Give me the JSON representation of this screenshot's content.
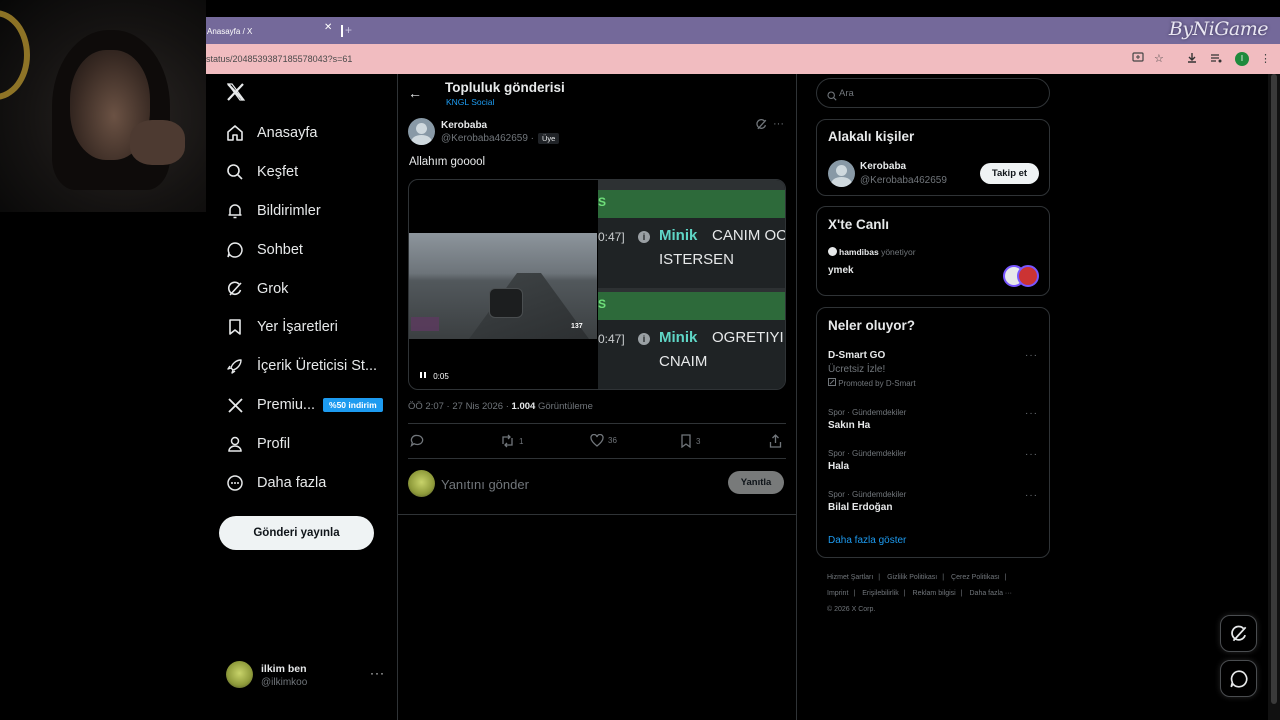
{
  "browser": {
    "tab_title": "Anasayfa / X",
    "tab_close": "✕",
    "new_tab": "+",
    "url": "status/2048539387185578043?s=61",
    "brand_watermark": "ByNiGame",
    "profile_initial": "I"
  },
  "nav": {
    "items": [
      {
        "label": "Anasayfa",
        "icon": "home-icon"
      },
      {
        "label": "Keşfet",
        "icon": "search-icon"
      },
      {
        "label": "Bildirimler",
        "icon": "bell-icon"
      },
      {
        "label": "Sohbet",
        "icon": "chat-icon"
      },
      {
        "label": "Grok",
        "icon": "grok-icon"
      },
      {
        "label": "Yer İşaretleri",
        "icon": "bookmark-icon"
      },
      {
        "label": "İçerik Üreticisi St...",
        "icon": "rocket-icon"
      },
      {
        "label": "Premiu...",
        "icon": "x-icon",
        "badge": "%50 indirim"
      },
      {
        "label": "Profil",
        "icon": "person-icon"
      },
      {
        "label": "Daha fazla",
        "icon": "more-circle-icon"
      }
    ],
    "post_button": "Gönderi yayınla",
    "account": {
      "name": "ilkim ben",
      "handle": "@ilkimkoo",
      "more": "···"
    }
  },
  "main": {
    "back": "←",
    "title": "Topluluk gönderisi",
    "community": "KNGL Social",
    "post": {
      "author": "Kerobaba",
      "handle": "@Kerobaba462659",
      "separator": "·",
      "member_badge": "Üye",
      "text": "Allahım gooool",
      "video_time": "0:05",
      "chat": [
        {
          "time": "0:47]",
          "user": "Minik",
          "msg": "CANIM OC",
          "msg2": "ISTERSEN"
        },
        {
          "time": "0:47]",
          "user": "Minik",
          "msg": "OGRETIYI",
          "msg2": "CNAIM"
        }
      ],
      "chat_markers": [
        "S",
        "S"
      ],
      "hud_speed": "137",
      "time": "ÖÖ 2:07",
      "date": "27 Nis 2026",
      "views": "1.004",
      "views_label": "Görüntüleme",
      "actions": {
        "replies": "",
        "reposts": "1",
        "likes": "36",
        "bookmarks": "3"
      },
      "more": "···"
    },
    "reply": {
      "placeholder": "Yanıtını gönder",
      "button": "Yanıtla"
    }
  },
  "right": {
    "search_placeholder": "Ara",
    "related": {
      "title": "Alakalı kişiler",
      "name": "Kerobaba",
      "handle": "@Kerobaba462659",
      "follow": "Takip et"
    },
    "live": {
      "title": "X'te Canlı",
      "host": "hamdibas",
      "host_suffix": "yönetiyor",
      "space_title": "ymek"
    },
    "trends": {
      "title": "Neler oluyor?",
      "items": [
        {
          "category": "",
          "title": "D-Smart GO",
          "subtitle": "Ücretsiz İzle!",
          "promo": "Promoted by D-Smart"
        },
        {
          "category": "Spor · Gündemdekiler",
          "title": "Sakın Ha"
        },
        {
          "category": "Spor · Gündemdekiler",
          "title": "Hala"
        },
        {
          "category": "Spor · Gündemdekiler",
          "title": "Bilal Erdoğan"
        }
      ],
      "show_more": "Daha fazla göster"
    },
    "footer": {
      "links": [
        "Hizmet Şartları",
        "Gizlilik Politikası",
        "Çerez Politikası",
        "Imprint",
        "Erişilebilirlik",
        "Reklam bilgisi",
        "Daha fazla ···"
      ],
      "copyright": "© 2026 X Corp."
    }
  },
  "colors": {
    "accent": "#1d9bf0",
    "tabbar": "#74699a",
    "urlbar": "#f1bcc0",
    "chat_name": "#5fd6c6"
  }
}
